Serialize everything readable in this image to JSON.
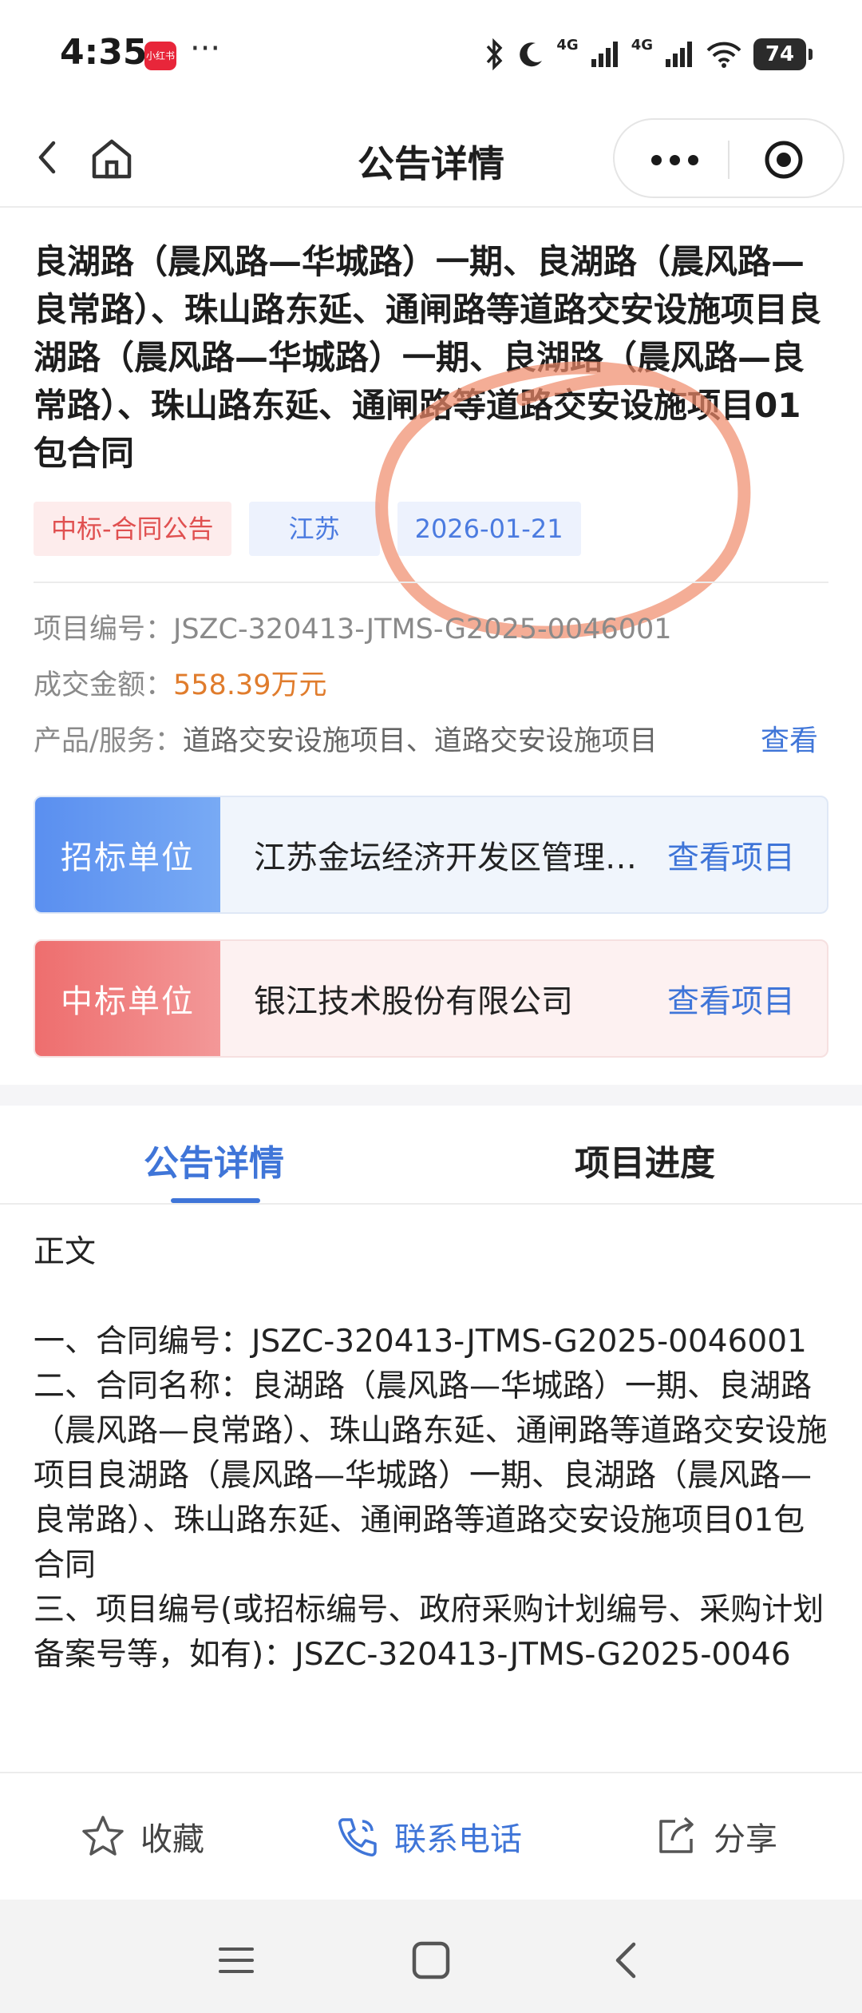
{
  "status_bar": {
    "time": "4:35",
    "app_badge": "小红书",
    "more": "···",
    "network": "4G",
    "network2": "4G",
    "battery": "74"
  },
  "nav": {
    "title": "公告详情"
  },
  "article": {
    "title": "良湖路（晨风路—华城路）一期、良湖路（晨风路—良常路）、珠山路东延、通闸路等道路交安设施项目良湖路（晨风路—华城路）一期、良湖路（晨风路—良常路）、珠山路东延、通闸路等道路交安设施项目01包合同",
    "tags": {
      "type": "中标-合同公告",
      "region": "江苏",
      "date": "2026-01-21"
    },
    "project_no_label": "项目编号：",
    "project_no": "JSZC-320413-JTMS-G2025-0046001",
    "amount_label": "成交金额：",
    "amount": "558.39万元",
    "product_label": "产品/服务：",
    "product": "道路交安设施项目、道路交安设施项目",
    "product_view": "查看"
  },
  "units": {
    "bidder_label": "招标单位",
    "bidder_name": "江苏金坛经济开发区管理委员会",
    "bidder_link": "查看项目",
    "winner_label": "中标单位",
    "winner_name": "银江技术股份有限公司",
    "winner_link": "查看项目"
  },
  "tabs": {
    "detail": "公告详情",
    "progress": "项目进度"
  },
  "body": {
    "heading": "正文",
    "line1": "一、合同编号：JSZC-320413-JTMS-G2025-0046001",
    "line2": "二、合同名称：良湖路（晨风路—华城路）一期、良湖路（晨风路—良常路）、珠山路东延、通闸路等道路交安设施项目良湖路（晨风路—华城路）一期、良湖路（晨风路—良常路）、珠山路东延、通闸路等道路交安设施项目01包合同",
    "line3": "三、项目编号(或招标编号、政府采购计划编号、采购计划备案号等，如有)：JSZC-320413-JTMS-G2025-0046"
  },
  "actions": {
    "favorite": "收藏",
    "phone": "联系电话",
    "share": "分享"
  },
  "colors": {
    "accent": "#3f75d8",
    "money": "#e07c2c",
    "tag_red": "#e05050",
    "annotation": "#f08a6a"
  },
  "icons": [
    "back-icon",
    "home-icon",
    "more-icon",
    "target-icon",
    "star-icon",
    "phone-icon",
    "share-icon",
    "menu-icon",
    "square-icon",
    "chevron-left-icon"
  ]
}
